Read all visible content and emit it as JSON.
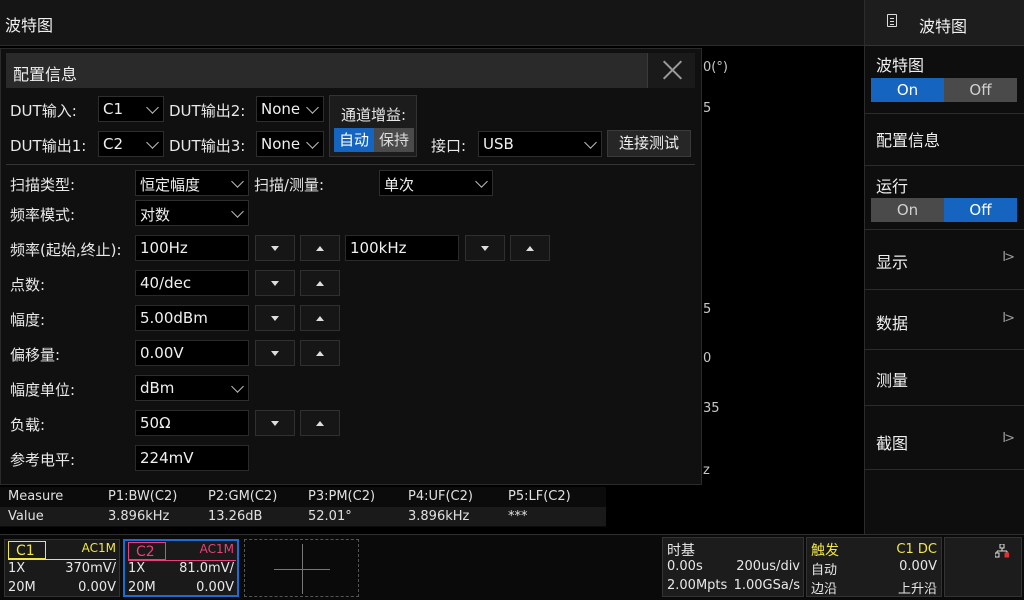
{
  "top_title": "波特图",
  "background_labels": [
    "0(°)",
    "5",
    "5",
    "0",
    "35",
    "z"
  ],
  "right_menu": {
    "header": "波特图",
    "bode": {
      "label": "波特图",
      "on": "On",
      "off": "Off",
      "state": "On"
    },
    "config": "配置信息",
    "run": {
      "label": "运行",
      "on": "On",
      "off": "Off",
      "state": "Off"
    },
    "display": "显示",
    "data": "数据",
    "measure": "测量",
    "screenshot": "截图",
    "arrow": "I>"
  },
  "dialog": {
    "title": "配置信息",
    "dut_in_label": "DUT输入:",
    "dut_in_value": "C1",
    "dut_out1_label": "DUT输出1:",
    "dut_out1_value": "C2",
    "dut_out2_label": "DUT输出2:",
    "dut_out2_value": "None",
    "dut_out3_label": "DUT输出3:",
    "dut_out3_value": "None",
    "gain_label": "通道增益:",
    "gain_auto": "自动",
    "gain_hold": "保持",
    "port_label": "接口:",
    "port_value": "USB",
    "connect_test": "连接测试",
    "sweep_type_label": "扫描类型:",
    "sweep_type_value": "恒定幅度",
    "sweep_measure_label": "扫描/测量:",
    "sweep_measure_value": "单次",
    "freq_mode_label": "频率模式:",
    "freq_mode_value": "对数",
    "freq_range_label": "频率(起始,终止):",
    "freq_start": "100Hz",
    "freq_stop": "100kHz",
    "points_label": "点数:",
    "points_value": "40/dec",
    "amplitude_label": "幅度:",
    "amplitude_value": "5.00dBm",
    "offset_label": "偏移量:",
    "offset_value": "0.00V",
    "amp_unit_label": "幅度单位:",
    "amp_unit_value": "dBm",
    "load_label": "负载:",
    "load_value": "50Ω",
    "ref_label": "参考电平:",
    "ref_value": "224mV"
  },
  "measure": {
    "headers": [
      "Measure",
      "P1:BW(C2)",
      "P2:GM(C2)",
      "P3:PM(C2)",
      "P4:UF(C2)",
      "P5:LF(C2)"
    ],
    "values": [
      "Value",
      "3.896kHz",
      "13.26dB",
      "52.01°",
      "3.896kHz",
      "***"
    ]
  },
  "channels": [
    {
      "name": "C1",
      "coupling": "AC1M",
      "probe": "1X",
      "scale": "370mV/",
      "bw": "20M",
      "offset": "0.00V",
      "color": "#f0e64a"
    },
    {
      "name": "C2",
      "coupling": "AC1M",
      "probe": "1X",
      "scale": "81.0mV/",
      "bw": "20M",
      "offset": "0.00V",
      "color": "#e8417a"
    }
  ],
  "timebase": {
    "title": "时基",
    "delay": "0.00s",
    "scale": "200us/div",
    "mem": "2.00Mpts",
    "rate": "1.00GSa/s"
  },
  "trigger": {
    "title": "触发",
    "source": "C1 DC",
    "mode": "自动",
    "level": "0.00V",
    "type": "边沿",
    "slope": "上升沿"
  }
}
